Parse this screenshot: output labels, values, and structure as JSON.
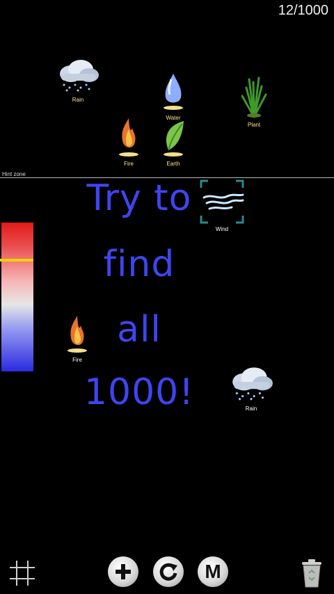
{
  "game": {
    "counter": "12/1000",
    "hint_zone_label": "Hint zone",
    "message_lines": [
      "Try to",
      "find",
      "all",
      "1000!"
    ]
  },
  "elements_top": [
    {
      "name": "Rain"
    },
    {
      "name": "Water"
    },
    {
      "name": "Plant"
    },
    {
      "name": "Fire"
    },
    {
      "name": "Earth"
    }
  ],
  "elements_play": [
    {
      "name": "Wind"
    },
    {
      "name": "Fire"
    },
    {
      "name": "Rain"
    }
  ],
  "toolbar": {
    "grid": "grid-icon",
    "add": "plus-icon",
    "refresh": "refresh-icon",
    "menu": "M",
    "trash": "trash-icon"
  },
  "colors": {
    "message_text": "#3f45f0",
    "label_text": "#ffe680",
    "thermo_marker": "#f2d400",
    "selection_frame": "#2b8a8a"
  }
}
